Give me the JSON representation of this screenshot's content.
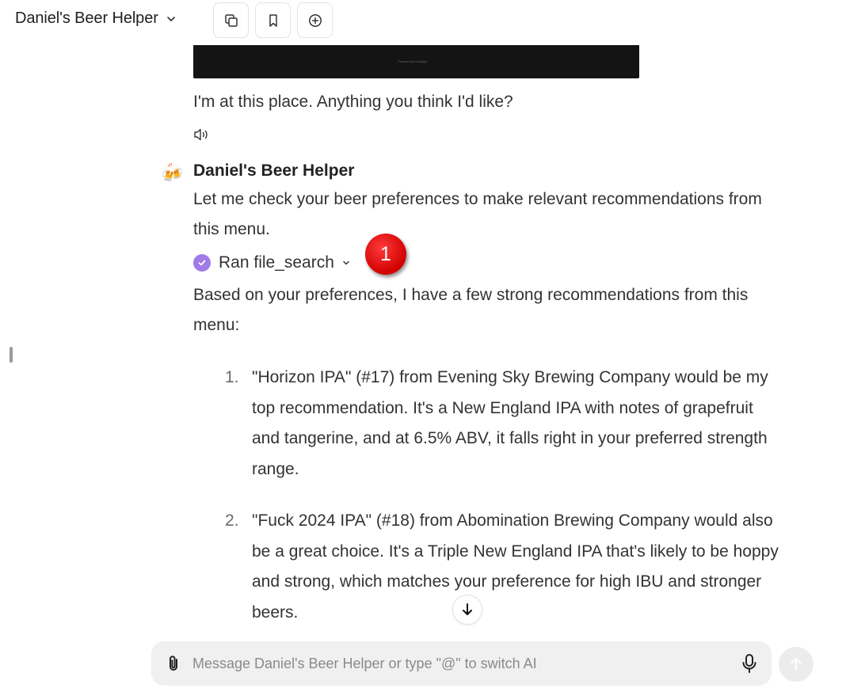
{
  "header": {
    "title": "Daniel's Beer Helper",
    "buttons": [
      {
        "icon": "copy-icon"
      },
      {
        "icon": "bookmark-icon"
      },
      {
        "icon": "plus-circle-icon"
      }
    ]
  },
  "conversation": {
    "image_caption": "Powered by Untappd",
    "user_message": "I'm at this place. Anything you think I'd like?",
    "assistant": {
      "avatar_icon": "🍻",
      "name": "Daniel's Beer Helper",
      "intro": "Let me check your beer preferences to make relevant recommendations from this menu.",
      "tool_status": "Ran file_search",
      "lead": "Based on your preferences, I have a few strong recommendations from this menu:",
      "recommendations": [
        {
          "num": "1.",
          "text": "\"Horizon IPA\" (#17) from Evening Sky Brewing Company would be my top recommendation. It's a New England IPA with notes of grapefruit and tangerine, and at 6.5% ABV, it falls right in your preferred strength range."
        },
        {
          "num": "2.",
          "text": "\"Fuck 2024 IPA\" (#18) from Abomination Brewing Company would also be a great choice. It's a Triple New England IPA that's likely to be hoppy and strong, which matches your preference for high IBU and stronger beers."
        }
      ]
    }
  },
  "annotation_marker": "1",
  "composer": {
    "placeholder": "Message Daniel's Beer Helper or type \"@\" to switch AI",
    "value": ""
  },
  "colors": {
    "accent_purple": "#a07ae6",
    "marker_red": "#d00000",
    "composer_bg": "#f0f0f0"
  }
}
